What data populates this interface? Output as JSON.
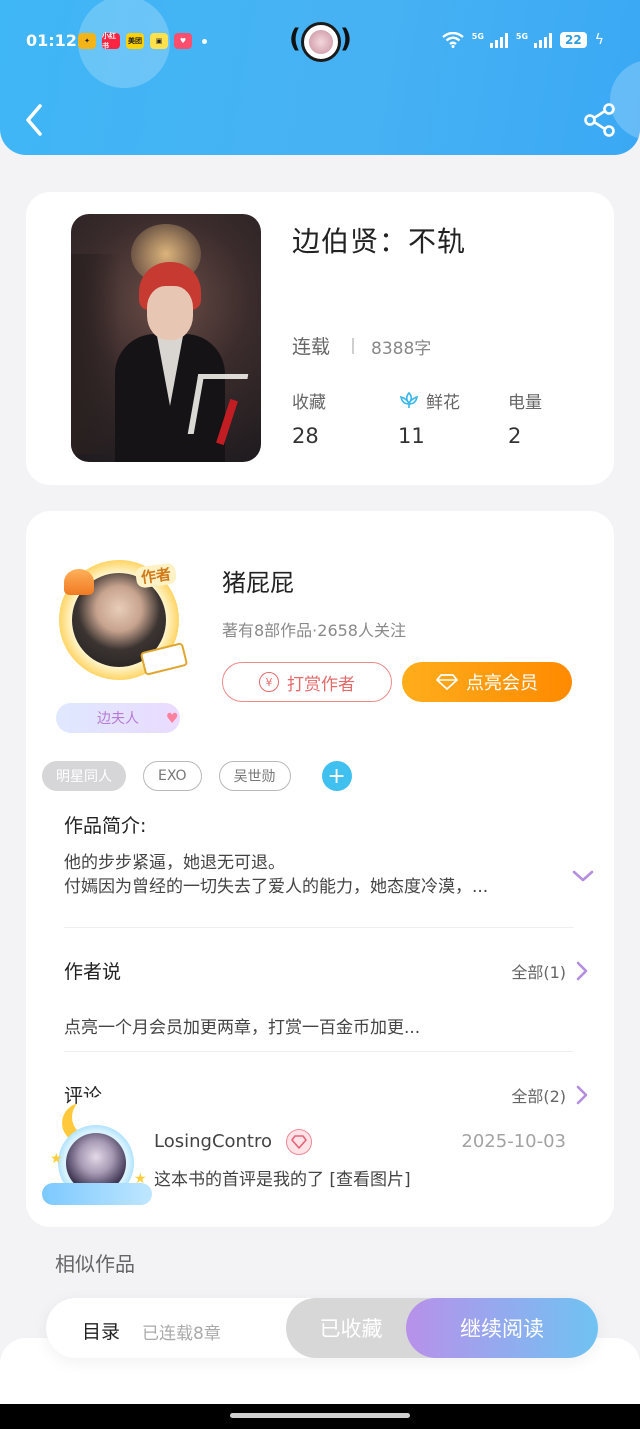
{
  "status_bar": {
    "time": "01:12",
    "apps": [
      "小红书",
      "美团"
    ],
    "network_badge_1": "5G",
    "network_badge_2": "5G",
    "battery": "22"
  },
  "colors": {
    "header": "#3fb6f6",
    "accent_orange": "#ff8a00",
    "accent_blue": "#3fc0ee",
    "read_gradient_start": "#b891ea",
    "read_gradient_end": "#6fc3f2"
  },
  "book": {
    "title": "边伯贤：不轨",
    "status": "连载",
    "word_count": "8388字",
    "stats": [
      {
        "label": "收藏",
        "value": "28"
      },
      {
        "label": "鲜花",
        "value": "11",
        "icon": "flower-icon"
      },
      {
        "label": "电量",
        "value": "2"
      }
    ]
  },
  "author": {
    "name": "猪屁屁",
    "avatar_tag": "作者",
    "fan_badge": "边夫人",
    "meta": "著有8部作品·2658人关注",
    "tip_button": "打赏作者",
    "vip_button": "点亮会员"
  },
  "tags": [
    "明星同人",
    "EXO",
    "吴世勋"
  ],
  "intro": {
    "title": "作品简介:",
    "line1": "他的步步紧逼，她退无可退。",
    "line2": "付嫣因为曾经的一切失去了爱人的能力，她态度冷漠，..."
  },
  "author_says": {
    "title": "作者说",
    "more": "全部(1)",
    "text": "点亮一个月会员加更两章，打赏一百金币加更..."
  },
  "comments": {
    "title": "评论",
    "more": "全部(2)",
    "items": [
      {
        "user": "LosingContro",
        "date": "2025-10-03",
        "text": "这本书的首评是我的了 [查看图片]"
      }
    ]
  },
  "similar_title": "相似作品",
  "bottom_bar": {
    "toc": "目录",
    "toc_sub": "已连载8章",
    "favorite": "已收藏",
    "continue": "继续阅读"
  }
}
